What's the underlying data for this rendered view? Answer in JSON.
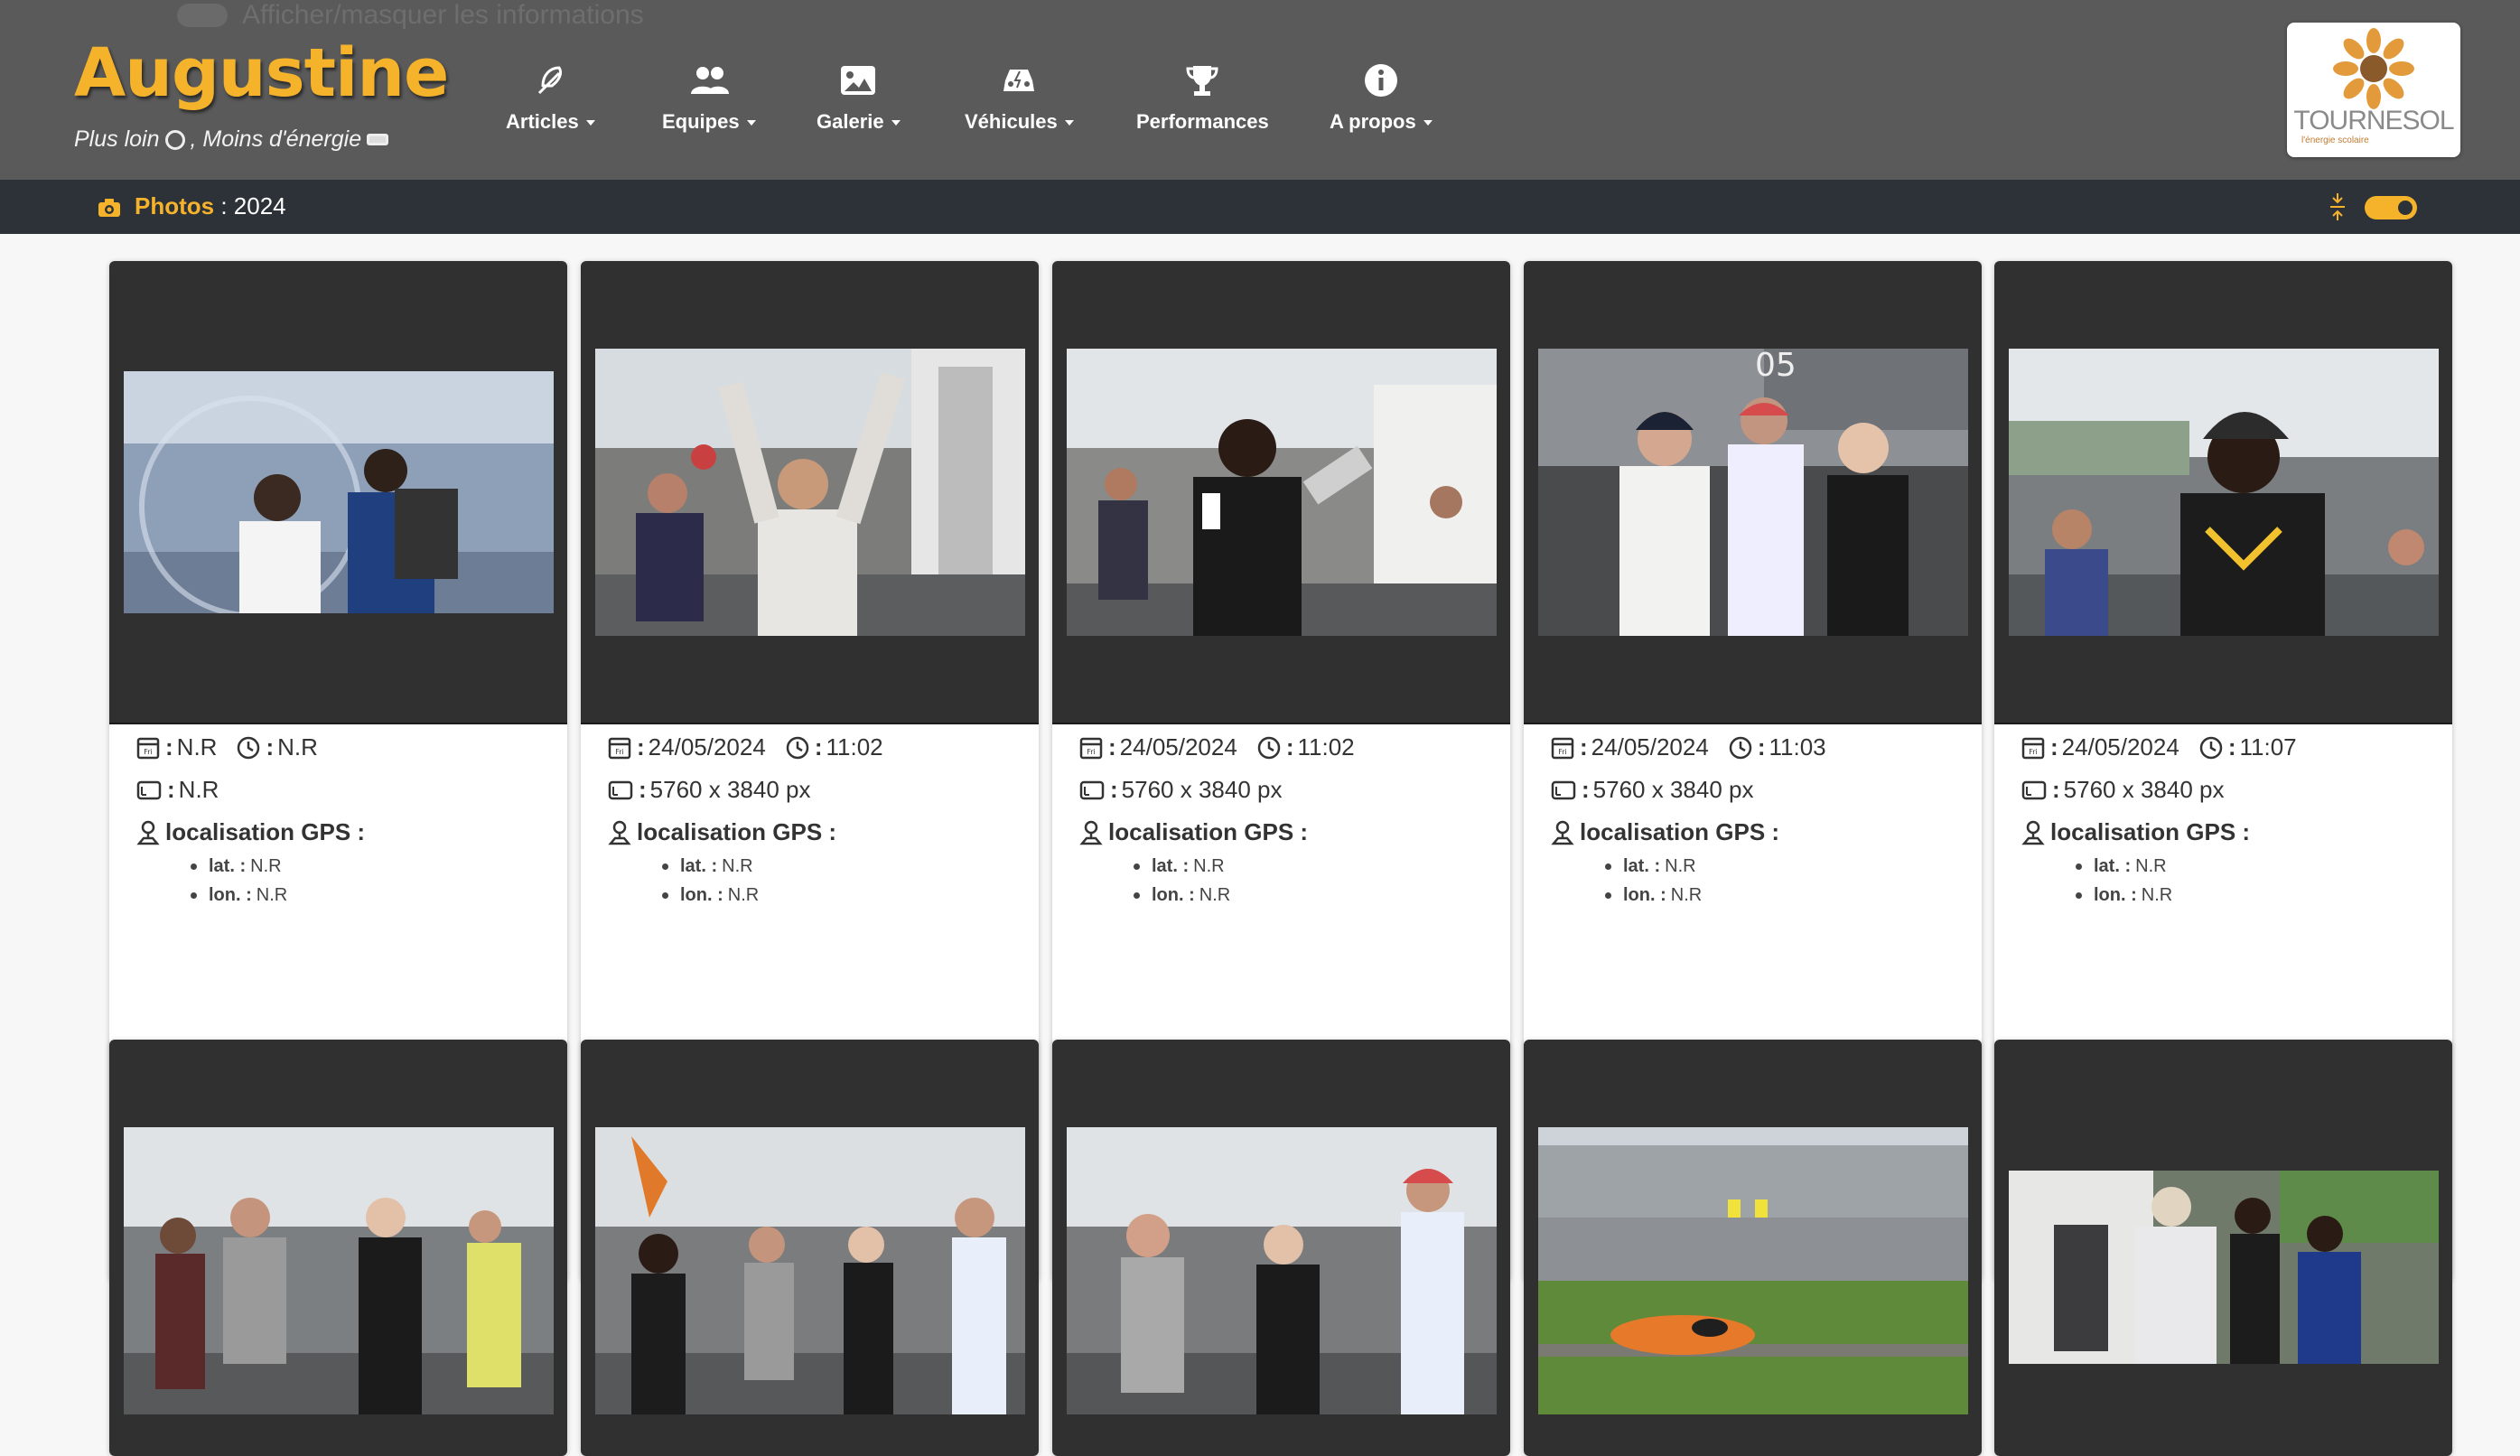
{
  "header": {
    "brand": "Augustine",
    "tagline_part1": "Plus loin",
    "tagline_part2": ", Moins d'énergie",
    "ghost_toggle_text": "Afficher/masquer les informations",
    "nav": [
      {
        "label": "Articles",
        "icon": "feather-icon",
        "dropdown": true
      },
      {
        "label": "Equipes",
        "icon": "users-icon",
        "dropdown": true
      },
      {
        "label": "Galerie",
        "icon": "image-icon",
        "dropdown": true
      },
      {
        "label": "Véhicules",
        "icon": "car-icon",
        "dropdown": true
      },
      {
        "label": "Performances",
        "icon": "trophy-icon",
        "dropdown": false
      },
      {
        "label": "A propos",
        "icon": "info-icon",
        "dropdown": true
      }
    ],
    "partner_logo": {
      "name": "TOURNESOL",
      "subtitle": "l'énergie scolaire"
    }
  },
  "subbar": {
    "section": "Photos",
    "separator": " : ",
    "year": "2024",
    "switch_on": true
  },
  "colors": {
    "accent": "#f5b32c",
    "navbar": "#5a5a5a",
    "subbar": "#2d3238",
    "photo_bg": "#303030"
  },
  "photos": [
    {
      "date": "N.R",
      "time": "N.R",
      "size": "N.R",
      "gps_label": "localisation GPS :",
      "lat_label": "lat. :",
      "lat": "N.R",
      "lon_label": "lon. :",
      "lon": "N.R"
    },
    {
      "date": "24/05/2024",
      "time": "11:02",
      "size": "5760 x 3840 px",
      "gps_label": "localisation GPS :",
      "lat_label": "lat. :",
      "lat": "N.R",
      "lon_label": "lon. :",
      "lon": "N.R"
    },
    {
      "date": "24/05/2024",
      "time": "11:02",
      "size": "5760 x 3840 px",
      "gps_label": "localisation GPS :",
      "lat_label": "lat. :",
      "lat": "N.R",
      "lon_label": "lon. :",
      "lon": "N.R"
    },
    {
      "date": "24/05/2024",
      "time": "11:03",
      "size": "5760 x 3840 px",
      "gps_label": "localisation GPS :",
      "lat_label": "lat. :",
      "lat": "N.R",
      "lon_label": "lon. :",
      "lon": "N.R"
    },
    {
      "date": "24/05/2024",
      "time": "11:07",
      "size": "5760 x 3840 px",
      "gps_label": "localisation GPS :",
      "lat_label": "lat. :",
      "lat": "N.R",
      "lon_label": "lon. :",
      "lon": "N.R"
    }
  ]
}
